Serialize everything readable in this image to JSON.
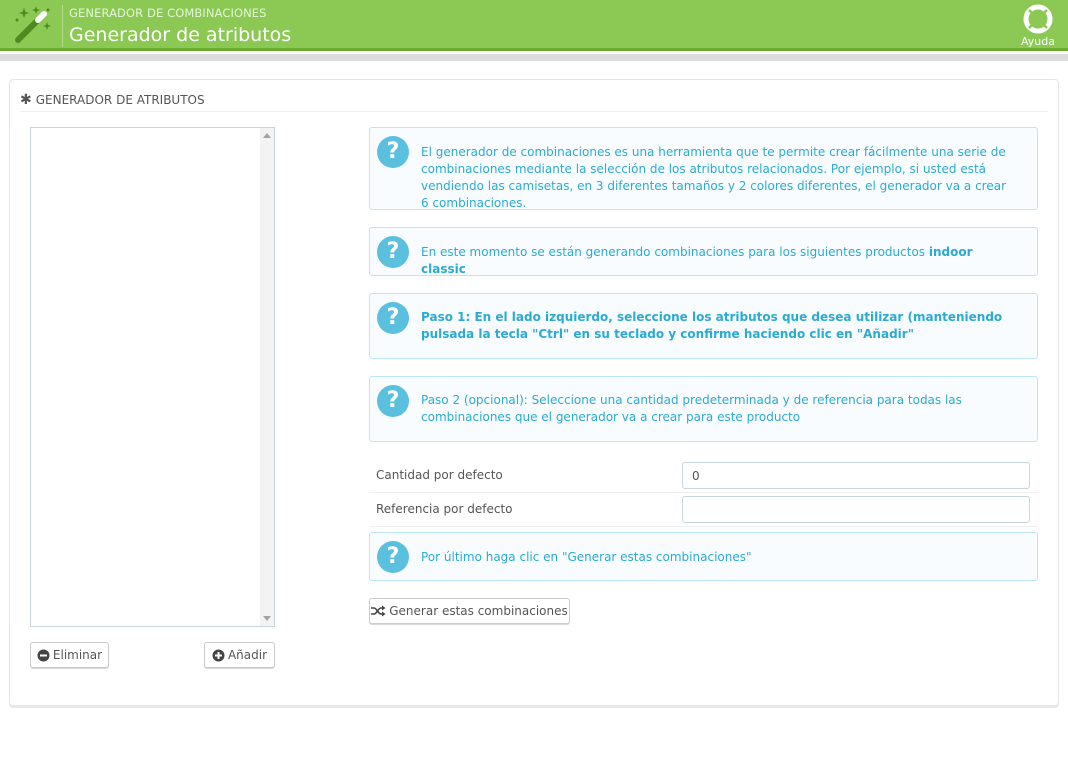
{
  "header": {
    "breadcrumb": "GENERADOR DE COMBINACIONES",
    "title": "Generador de atributos",
    "help_label": "Ayuda",
    "icons": {
      "app": "magic-wand-icon",
      "help": "lifebuoy-icon"
    },
    "colors": {
      "bar": "#8bc954",
      "bar_border": "#6aab2d"
    }
  },
  "panel": {
    "heading": "GENERADOR DE ATRIBUTOS",
    "heading_icon": "asterisk-icon"
  },
  "attributes": {
    "remove_label": "Eliminar",
    "add_label": "Añadir",
    "remove_icon": "minus-circle-icon",
    "add_icon": "plus-circle-icon"
  },
  "alerts": {
    "intro": "El generador de combinaciones es una herramienta que te permite crear fácilmente una serie de combinaciones mediante la selección de los atributos relacionados. Por ejemplo, si usted está vendiendo las camisetas, en 3 diferentes tamaños y 2 colores diferentes, el generador va a crear 6 combinaciones.",
    "current_text": "En este momento se están generando combinaciones para los siguientes productos",
    "current_product": "indoor classic",
    "step1": "Paso 1: En el lado izquierdo, seleccione los atributos que desea utilizar (manteniendo pulsada la tecla \"Ctrl\" en su teclado y confirme haciendo clic en \"Añadir\"",
    "step2": "Paso 2 (opcional): Seleccione una cantidad predeterminada y de referencia para todas las combinaciones que el generador va a crear para este producto",
    "final": "Por último haga clic en \"Generar estas combinaciones\"",
    "icon": "question-circle-icon",
    "colors": {
      "text": "#2babd2",
      "icon_bg": "#5bc0de",
      "border": "#bde5f8"
    }
  },
  "form": {
    "quantity_label": "Cantidad por defecto",
    "quantity_value": "0",
    "reference_label": "Referencia por defecto",
    "reference_value": ""
  },
  "generate": {
    "label": "Generar estas combinaciones",
    "icon": "shuffle-icon"
  }
}
